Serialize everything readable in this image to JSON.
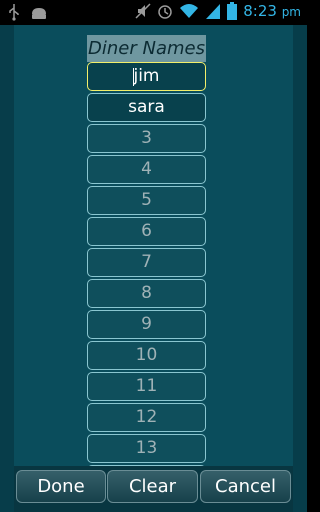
{
  "status_bar": {
    "time": "8:23",
    "ampm": "pm",
    "icons": [
      "usb-icon",
      "android-icon",
      "mute-icon",
      "alarm-icon",
      "wifi-icon",
      "signal-icon",
      "battery-icon"
    ]
  },
  "list": {
    "header": "Diner Names",
    "items": [
      {
        "text": "jim",
        "filled": true,
        "focused": true
      },
      {
        "text": "sara",
        "filled": true,
        "focused": false
      },
      {
        "text": "3",
        "filled": false,
        "focused": false
      },
      {
        "text": "4",
        "filled": false,
        "focused": false
      },
      {
        "text": "5",
        "filled": false,
        "focused": false
      },
      {
        "text": "6",
        "filled": false,
        "focused": false
      },
      {
        "text": "7",
        "filled": false,
        "focused": false
      },
      {
        "text": "8",
        "filled": false,
        "focused": false
      },
      {
        "text": "9",
        "filled": false,
        "focused": false
      },
      {
        "text": "10",
        "filled": false,
        "focused": false
      },
      {
        "text": "11",
        "filled": false,
        "focused": false
      },
      {
        "text": "12",
        "filled": false,
        "focused": false
      },
      {
        "text": "13",
        "filled": false,
        "focused": false
      },
      {
        "text": "",
        "filled": false,
        "focused": false
      }
    ]
  },
  "buttons": {
    "done": "Done",
    "clear": "Clear",
    "cancel": "Cancel"
  },
  "colors": {
    "accent": "#33b5e5",
    "background": "#073d4a",
    "focus_border": "#f3ef6a"
  }
}
